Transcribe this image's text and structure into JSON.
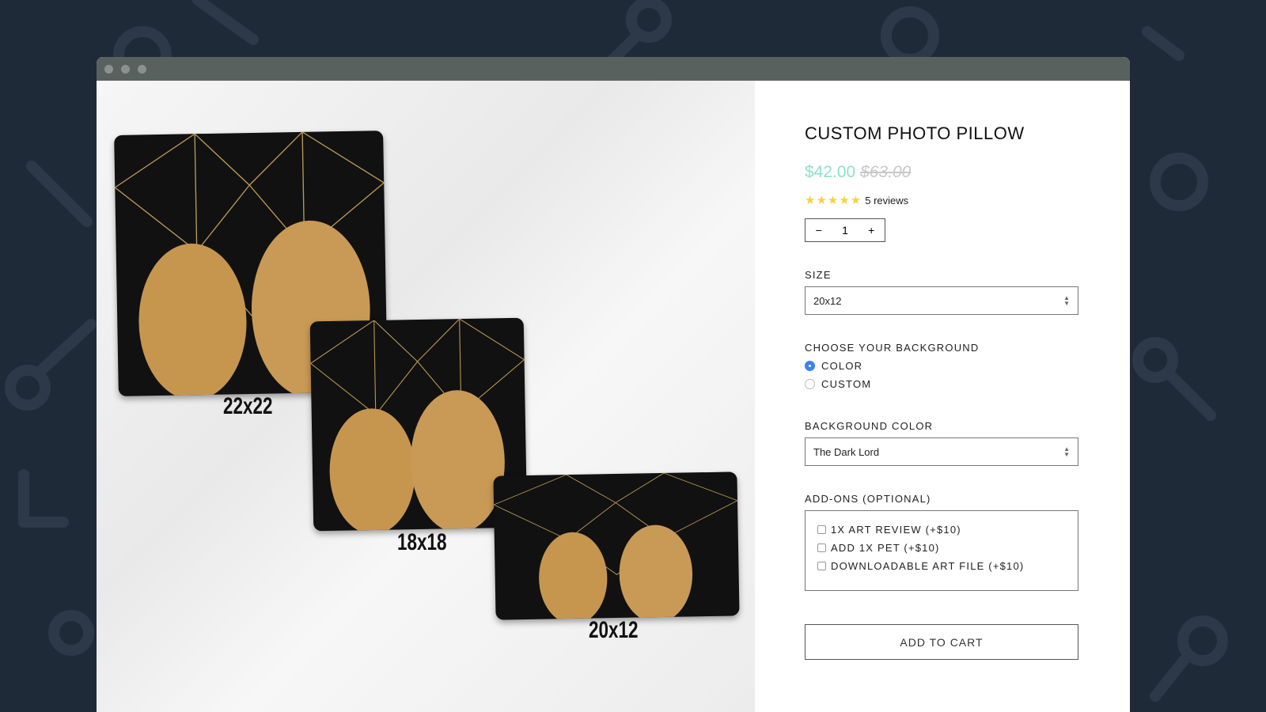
{
  "window": {
    "controls": [
      "close",
      "minimize",
      "maximize"
    ]
  },
  "hero": {
    "size_labels": [
      "22x22",
      "18x18",
      "20x12"
    ]
  },
  "product": {
    "title": "CUSTOM PHOTO PILLOW",
    "price": "$42.00",
    "compare_price": "$63.00",
    "rating": 5,
    "stars": "★★★★★",
    "reviews": "5 reviews",
    "quantity": {
      "minus": "−",
      "value": "1",
      "plus": "+"
    },
    "size": {
      "label": "SIZE",
      "value": "20x12"
    },
    "background": {
      "label": "CHOOSE YOUR BACKGROUND",
      "options": [
        {
          "label": "COLOR",
          "selected": true
        },
        {
          "label": "CUSTOM",
          "selected": false
        }
      ]
    },
    "background_color": {
      "label": "BACKGROUND COLOR",
      "value": "The Dark Lord"
    },
    "addons": {
      "label": "ADD-ONS (OPTIONAL)",
      "items": [
        "1X ART REVIEW (+$10)",
        "ADD 1X PET (+$10)",
        "DOWNLOADABLE ART FILE (+$10)"
      ]
    },
    "add_to_cart": "ADD TO CART"
  },
  "colors": {
    "price": "#8ee0cc",
    "radio_selected": "#3b82f6",
    "star": "#f6d33c",
    "page_bg": "#1f2a38"
  }
}
